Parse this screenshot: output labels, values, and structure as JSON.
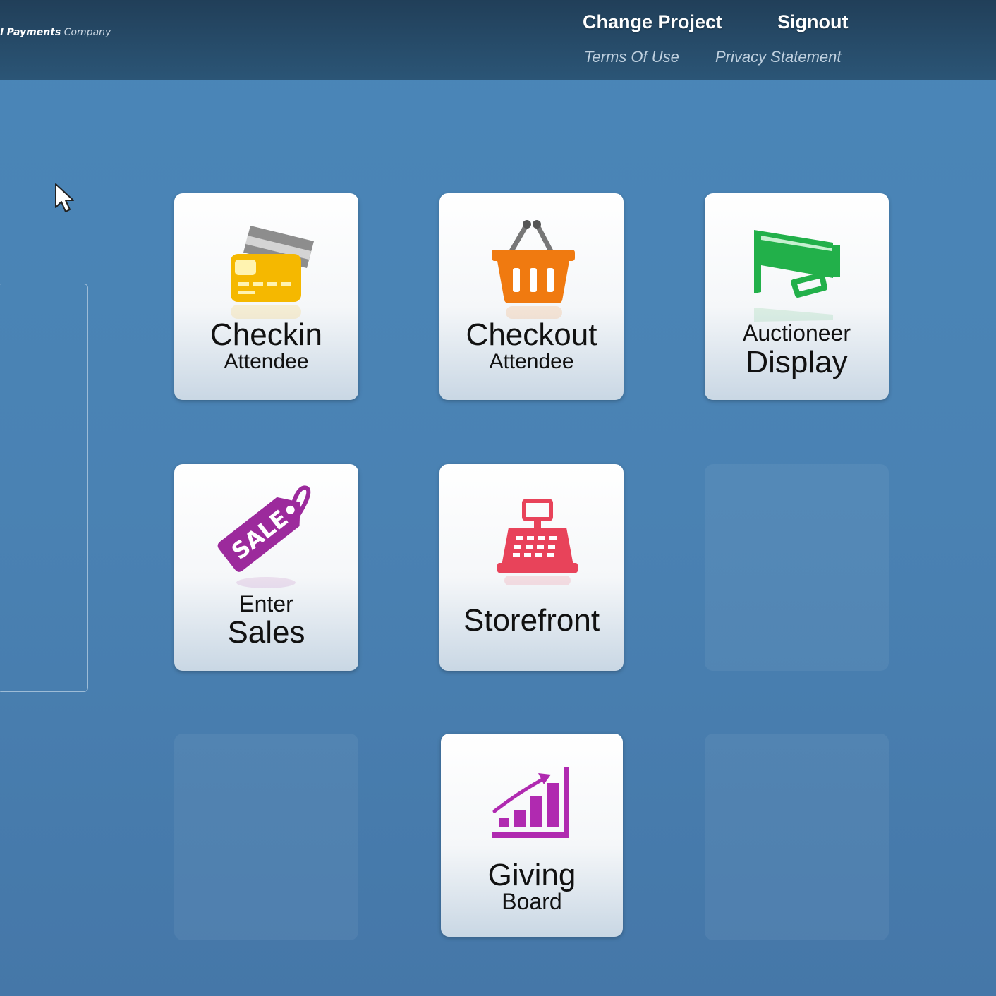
{
  "header": {
    "brand_prefix": "l Payments",
    "brand_suffix": "Company",
    "change_project": "Change Project",
    "signout": "Signout",
    "terms": "Terms Of Use",
    "privacy": "Privacy Statement"
  },
  "tiles": {
    "checkin": {
      "big": "Checkin",
      "small": "Attendee",
      "icon": "credit-card-icon",
      "color": "#f5b800"
    },
    "checkout": {
      "big": "Checkout",
      "small": "Attendee",
      "icon": "basket-icon",
      "color": "#f07a10"
    },
    "auctioneer": {
      "small": "Auctioneer",
      "big": "Display",
      "icon": "megaphone-icon",
      "color": "#22b04a"
    },
    "sales": {
      "small": "Enter",
      "big": "Sales",
      "icon": "sale-tag-icon",
      "color": "#9c2a9c",
      "tag_text": "SALE"
    },
    "storefront": {
      "big": "Storefront",
      "icon": "cash-register-icon",
      "color": "#e8435a"
    },
    "giving": {
      "big": "Giving",
      "small": "Board",
      "icon": "bar-chart-icon",
      "color": "#b02ab0"
    }
  }
}
